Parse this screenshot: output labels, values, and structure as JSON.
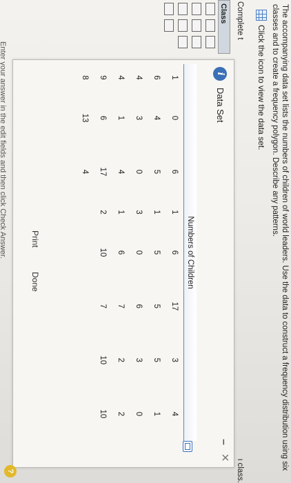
{
  "question": "The accompanying data set lists the numbers of children of world leaders. Use the data to construct a frequency distribution using six classes and to create a frequency polygon. Describe any patterns.",
  "view_data_link": "Click the icon to view the data set.",
  "complete_label": "Complete t",
  "complete_right": "ι class.",
  "table_header_class": "Class",
  "dialog": {
    "title": "Data Set",
    "minimize_label": "–",
    "close_label": "×",
    "info_glyph": "i",
    "table_header": "Numbers of Children",
    "rows": [
      [
        "1",
        "0",
        "6",
        "1",
        "6",
        "17",
        "3",
        "4"
      ],
      [
        "6",
        "4",
        "5",
        "1",
        "5",
        "5",
        "5",
        "1"
      ],
      [
        "4",
        "3",
        "0",
        "3",
        "0",
        "6",
        "3",
        "0"
      ],
      [
        "4",
        "1",
        "4",
        "1",
        "6",
        "7",
        "2",
        "2"
      ],
      [
        "9",
        "6",
        "17",
        "2",
        "10",
        "7",
        "10",
        "10"
      ],
      [
        "8",
        "13",
        "4",
        "",
        "",
        "",
        "",
        ""
      ]
    ],
    "print_label": "Print",
    "done_label": "Done"
  },
  "bottom_text": "Enter your answer in the edit fields and then click Check Answer.",
  "help_label": "?"
}
